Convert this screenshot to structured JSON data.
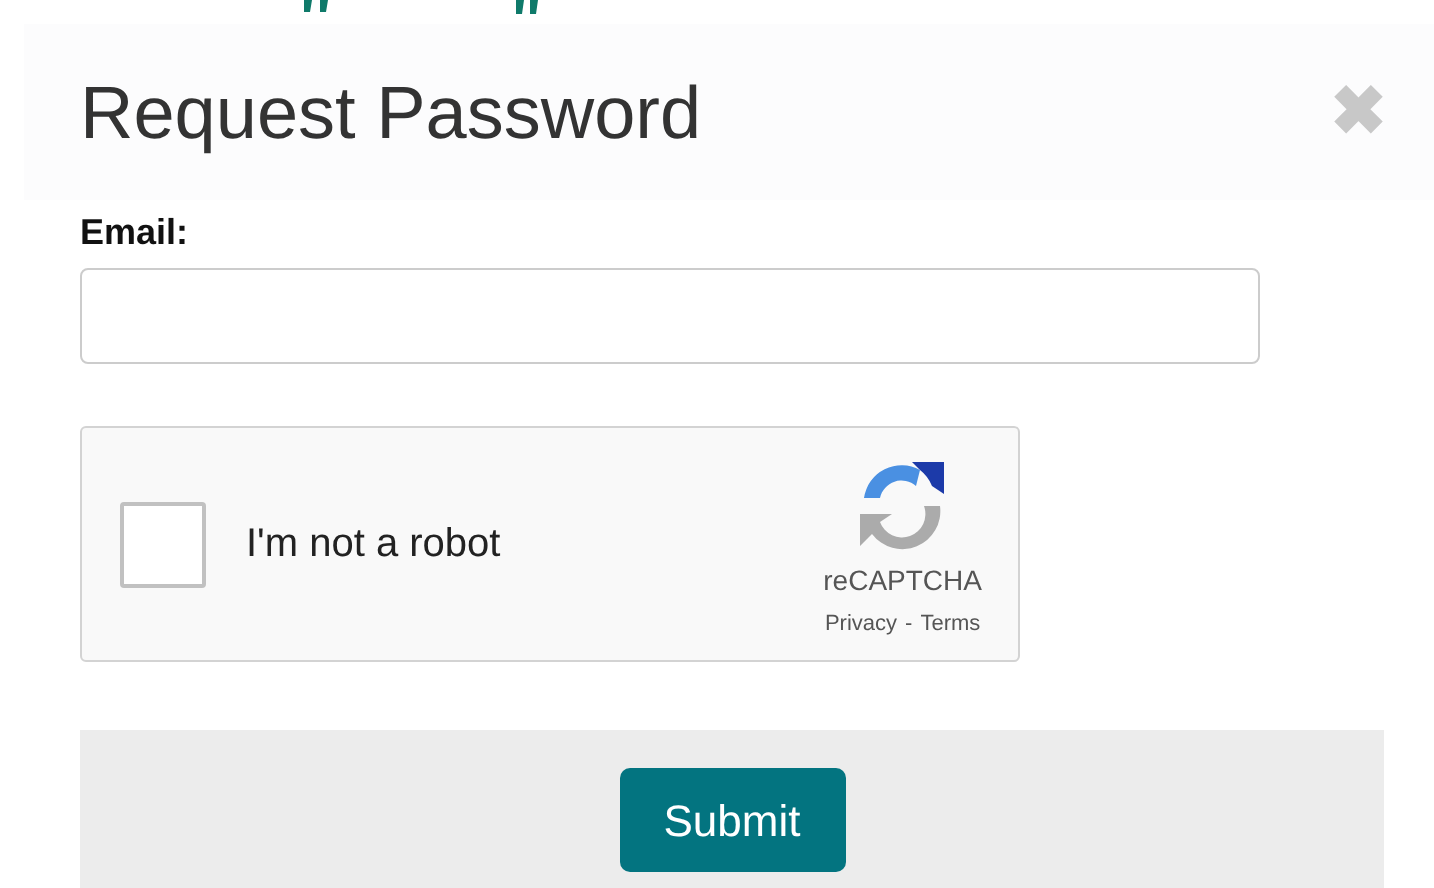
{
  "dialog": {
    "title": "Request Password",
    "close": "✖"
  },
  "email": {
    "label": "Email:"
  },
  "captcha": {
    "checked": false,
    "label": "I'm not a robot",
    "brand": "reCAPTCHA",
    "privacy": "Privacy",
    "separator": "-",
    "terms": "Terms"
  },
  "submit": "Submit"
}
